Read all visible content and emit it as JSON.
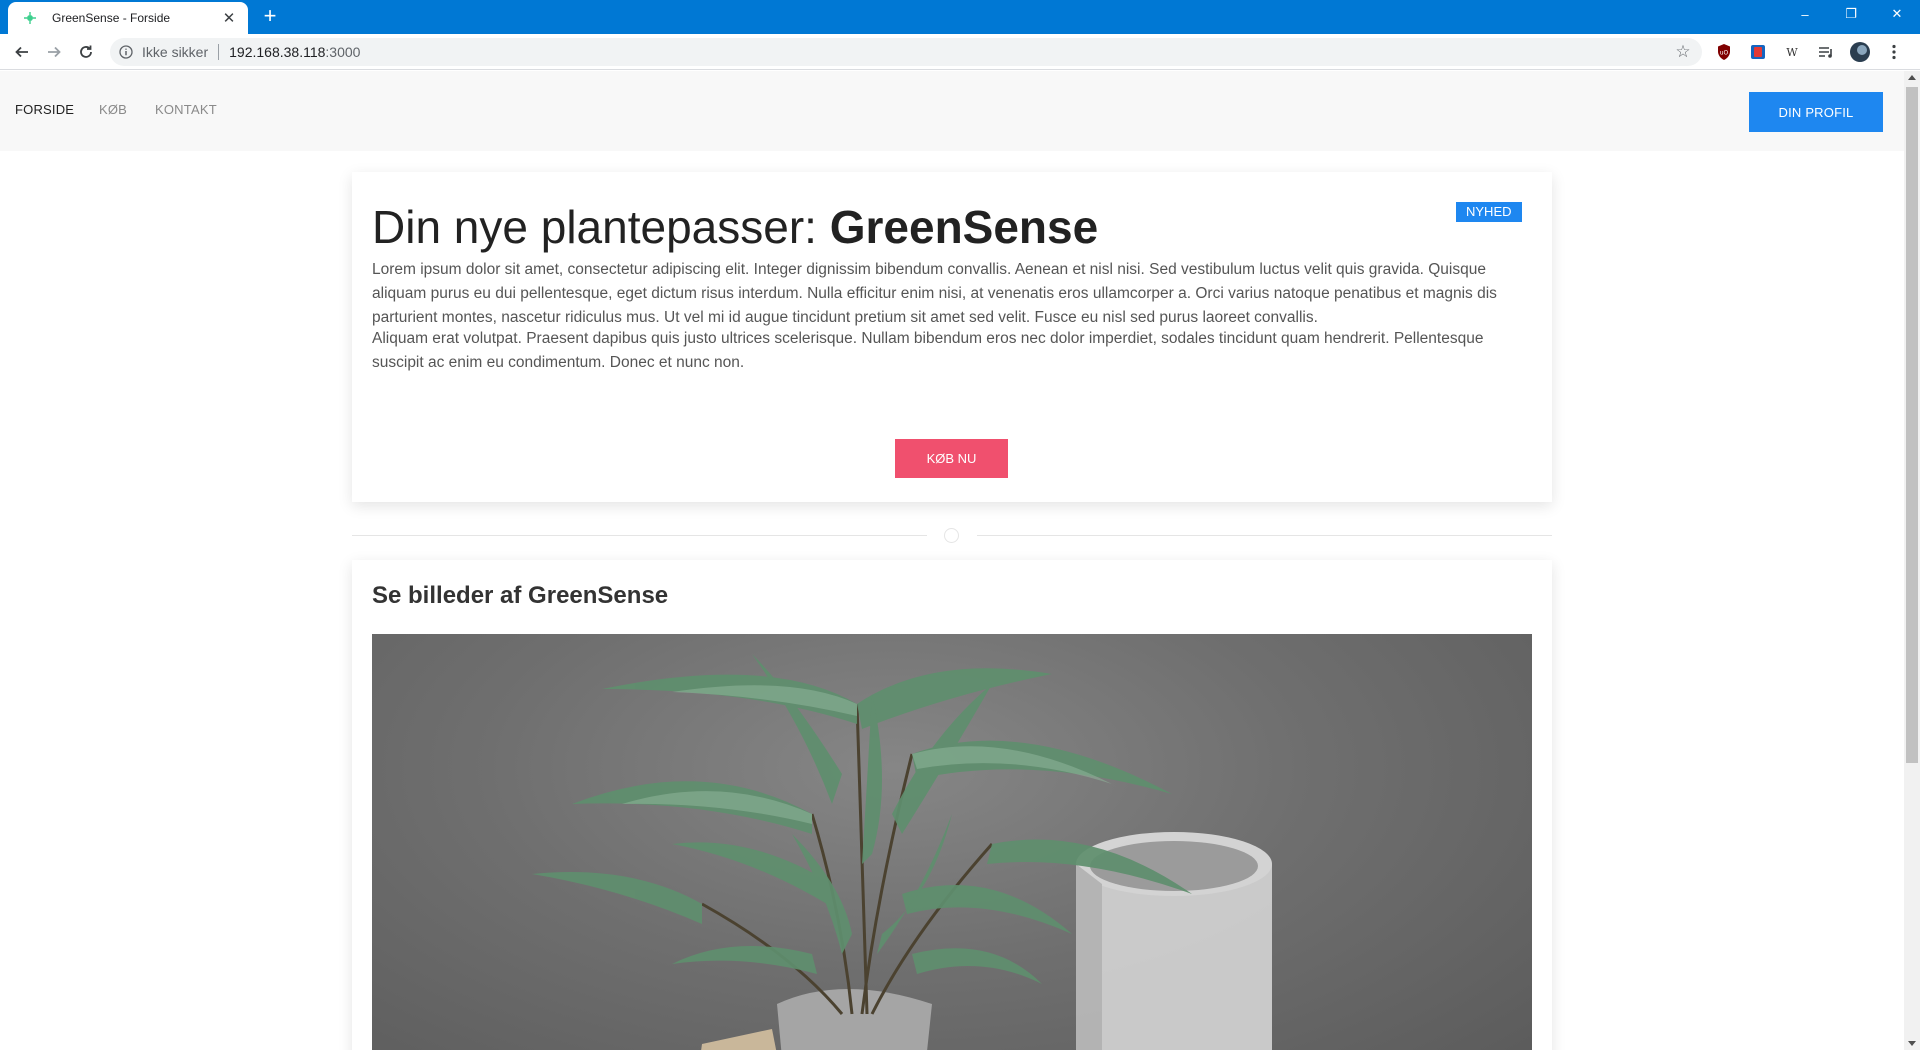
{
  "browser": {
    "tab_title": "GreenSense - Forside",
    "new_tab": "+",
    "close_tab": "✕",
    "security_label": "Ikke sikker",
    "url_host": "192.168.38.118",
    "url_port": ":3000",
    "window_controls": {
      "minimize": "–",
      "restore": "❐",
      "close": "✕"
    }
  },
  "nav": {
    "items": [
      "FORSIDE",
      "KØB",
      "KONTAKT"
    ],
    "active_index": 0,
    "profile_button": "DIN PROFIL"
  },
  "hero": {
    "title_prefix": "Din nye plantepasser: ",
    "title_brand": "GreenSense",
    "badge": "NYHED",
    "paragraph1": "Lorem ipsum dolor sit amet, consectetur adipiscing elit. Integer dignissim bibendum convallis. Aenean et nisl nisi. Sed vestibulum luctus velit quis gravida. Quisque aliquam purus eu dui pellentesque, eget dictum risus interdum. Nulla efficitur enim nisi, at venenatis eros ullamcorper a. Orci varius natoque penatibus et magnis dis parturient montes, nascetur ridiculus mus. Ut vel mi id augue tincidunt pretium sit amet sed velit. Fusce eu nisl sed purus laoreet convallis.",
    "paragraph2": "Aliquam erat volutpat. Praesent dapibus quis justo ultrices scelerisque. Nullam bibendum eros nec dolor imperdiet, sodales tincidunt quam hendrerit. Pellentesque suscipit ac enim eu condimentum. Donec et nunc non.",
    "buy_button": "KØB NU"
  },
  "gallery": {
    "title": "Se billeder af GreenSense"
  },
  "colors": {
    "chrome_blue": "#0078d4",
    "primary": "#1e87f0",
    "danger": "#f0506e"
  }
}
